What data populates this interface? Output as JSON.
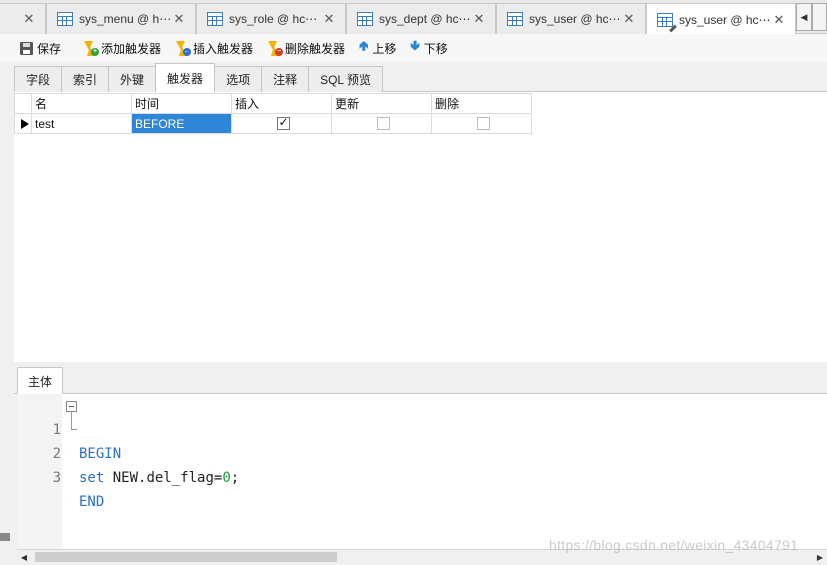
{
  "doc_tabs": [
    {
      "label": "sys_menu @ h⋯",
      "close": "✕"
    },
    {
      "label": "sys_role @ hc⋯",
      "close": "✕"
    },
    {
      "label": "sys_dept @ hc⋯",
      "close": "✕"
    },
    {
      "label": "sys_user @ hc⋯",
      "close": "✕"
    },
    {
      "label": "sys_user @ hc⋯",
      "close": "✕"
    }
  ],
  "doc_tab_leading_close": "✕",
  "toolbar": {
    "save": "保存",
    "add_trigger": "添加触发器",
    "insert_trigger": "插入触发器",
    "delete_trigger": "删除触发器",
    "move_up": "上移",
    "move_down": "下移"
  },
  "prop_tabs": [
    {
      "label": "字段"
    },
    {
      "label": "索引"
    },
    {
      "label": "外键"
    },
    {
      "label": "触发器"
    },
    {
      "label": "选项"
    },
    {
      "label": "注释"
    },
    {
      "label": "SQL 预览"
    }
  ],
  "grid": {
    "columns": [
      "名",
      "时间",
      "插入",
      "更新",
      "删除"
    ],
    "rows": [
      {
        "name": "test",
        "time": "BEFORE",
        "insert": true,
        "update": false,
        "delete": false
      }
    ]
  },
  "body_tab": "主体",
  "editor": {
    "lines": [
      {
        "num": "1",
        "text": "BEGIN"
      },
      {
        "num": "2",
        "kw": "set",
        "rest": " NEW.del_flag=",
        "value": "0",
        "end": ";"
      },
      {
        "num": "3",
        "text": "END"
      }
    ]
  },
  "watermark": "https://blog.csdn.net/weixin_43404791",
  "colors": {
    "selection": "#2f86d6",
    "keyword": "#2a6fc9",
    "number": "#1e9e3c"
  }
}
